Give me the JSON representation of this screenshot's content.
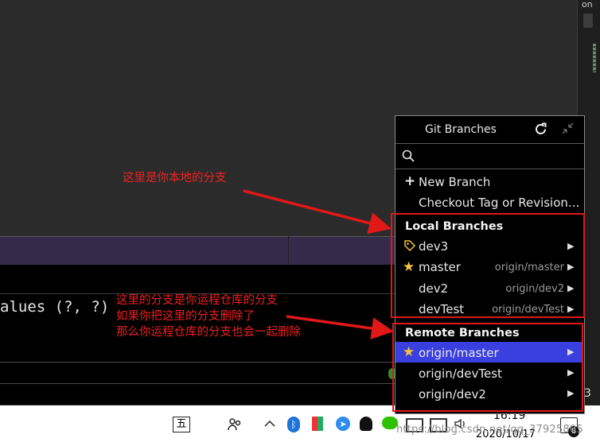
{
  "side_strip": {
    "label": "on"
  },
  "console": {
    "text": "alues (?, ?)"
  },
  "popup": {
    "title": "Git Branches",
    "search": {
      "value": "",
      "placeholder": ""
    },
    "actions": [
      {
        "label": "New Branch",
        "icon": "plus-icon"
      },
      {
        "label": "Checkout Tag or Revision..."
      }
    ],
    "local_section": "Local Branches",
    "local_branches": [
      {
        "name": "dev3",
        "tracking": "",
        "icon": "tag-icon"
      },
      {
        "name": "master",
        "tracking": "origin/master",
        "icon": "star-icon"
      },
      {
        "name": "dev2",
        "tracking": "origin/dev2"
      },
      {
        "name": "devTest",
        "tracking": "origin/devTest"
      }
    ],
    "remote_section": "Remote Branches",
    "remote_branches": [
      {
        "name": "origin/master",
        "icon": "star-icon",
        "selected": true
      },
      {
        "name": "origin/devTest"
      },
      {
        "name": "origin/dev2"
      }
    ]
  },
  "annotations": {
    "local": "这里是你本地的分支",
    "remote_lines": [
      "这里的分支是你运程仓库的分支",
      "如果你把这里的分支删除了",
      "那么你运程仓库的分支也会一起删除"
    ]
  },
  "taskbar": {
    "ime": "五",
    "time": "16:19",
    "date": "2020/10/17",
    "notification_count": "8",
    "watermark": "https://blog.csdn.net/qq_37925805"
  },
  "stray_digit": "3",
  "colors": {
    "selection": "#3a3fe0",
    "annotation": "#e01818",
    "star": "#f7c33a",
    "popup_bg": "#000000"
  }
}
